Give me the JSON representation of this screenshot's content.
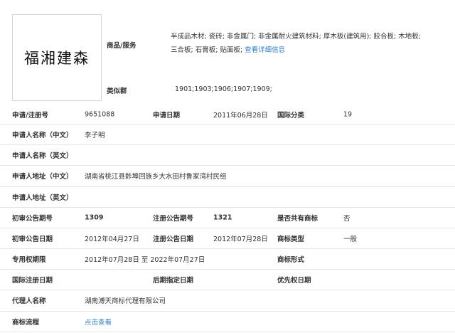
{
  "logo_text": "福湘建森",
  "services": {
    "label": "商品/服务",
    "line1": "半成品木材; 瓷砖; 非金属门; 非金属耐火建筑材料; 厚木板(建筑用); 胶合板; 木地板;",
    "line2_prefix": "三合板; 石膏板; 贴面板; ",
    "detail_link": "查看详细信息"
  },
  "similar": {
    "label": "类似群",
    "value": "1901;1903;1906;1907;1909;"
  },
  "rows": {
    "reg_no": {
      "label": "申请/注册号",
      "value": "9651088"
    },
    "app_date": {
      "label": "申请日期",
      "value": "2011年06月28日"
    },
    "intl_class": {
      "label": "国际分类",
      "value": "19"
    },
    "applicant_cn": {
      "label": "申请人名称（中文）",
      "value": "李子明"
    },
    "applicant_en": {
      "label": "申请人名称（英文）",
      "value": ""
    },
    "address_cn": {
      "label": "申请人地址（中文）",
      "value": "湖南省桃江县鲊埠回族乡大水田村鲁家湾村民组"
    },
    "address_en": {
      "label": "申请人地址（英文）",
      "value": ""
    },
    "prelim_pub_no": {
      "label": "初审公告期号",
      "value": "1309"
    },
    "reg_pub_no": {
      "label": "注册公告期号",
      "value": "1321"
    },
    "shared": {
      "label": "是否共有商标",
      "value": "否"
    },
    "prelim_pub_date": {
      "label": "初审公告日期",
      "value": "2012年04月27日"
    },
    "reg_pub_date": {
      "label": "注册公告日期",
      "value": "2012年07月28日"
    },
    "tm_type": {
      "label": "商标类型",
      "value": "一般"
    },
    "exclusive": {
      "label": "专用权期限",
      "value": "2012年07月28日 至 2022年07月27日"
    },
    "tm_form": {
      "label": "商标形式",
      "value": ""
    },
    "intl_reg_date": {
      "label": "国际注册日期",
      "value": ""
    },
    "later_date": {
      "label": "后期指定日期",
      "value": ""
    },
    "priority_date": {
      "label": "优先权日期",
      "value": ""
    },
    "agent": {
      "label": "代理人名称",
      "value": "湖南溥天商标代理有限公司"
    },
    "process": {
      "label": "商标流程",
      "value": "点击查看"
    }
  }
}
